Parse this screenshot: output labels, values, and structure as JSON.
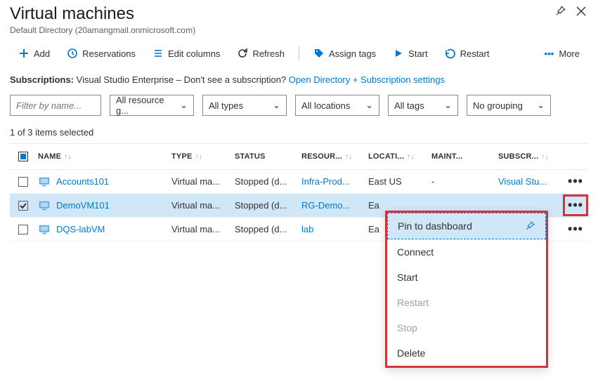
{
  "header": {
    "title": "Virtual machines",
    "subtitle": "Default Directory (20amangmail.onmicrosoft.com)"
  },
  "toolbar": {
    "add": "Add",
    "reservations": "Reservations",
    "edit_columns": "Edit columns",
    "refresh": "Refresh",
    "assign_tags": "Assign tags",
    "start": "Start",
    "restart": "Restart",
    "more": "More"
  },
  "subs": {
    "label": "Subscriptions:",
    "text": "Visual Studio Enterprise – Don't see a subscription?",
    "link1": "Open Directory + Subscription settings"
  },
  "filters": {
    "name_placeholder": "Filter by name...",
    "rg": "All resource g...",
    "types": "All types",
    "locations": "All locations",
    "tags": "All tags",
    "grouping": "No grouping"
  },
  "selcount": "1 of 3 items selected",
  "columns": {
    "name": "NAME",
    "type": "TYPE",
    "status": "STATUS",
    "rg": "RESOUR...",
    "loc": "LOCATI...",
    "maint": "MAINT...",
    "subscr": "SUBSCR..."
  },
  "rows": [
    {
      "name": "Accounts101",
      "type": "Virtual ma...",
      "status": "Stopped (d...",
      "rg": "Infra-Prod...",
      "loc": "East US",
      "maint": "-",
      "subscr": "Visual Stu...",
      "checked": false
    },
    {
      "name": "DemoVM101",
      "type": "Virtual ma...",
      "status": "Stopped (d...",
      "rg": "RG-Demo...",
      "loc": "Ea",
      "maint": "",
      "subscr": "",
      "checked": true
    },
    {
      "name": "DQS-labVM",
      "type": "Virtual ma...",
      "status": "Stopped (d...",
      "rg": "lab",
      "loc": "Ea",
      "maint": "",
      "subscr": "",
      "checked": false
    }
  ],
  "menu": {
    "pin": "Pin to dashboard",
    "connect": "Connect",
    "start": "Start",
    "restart": "Restart",
    "stop": "Stop",
    "delete": "Delete"
  }
}
